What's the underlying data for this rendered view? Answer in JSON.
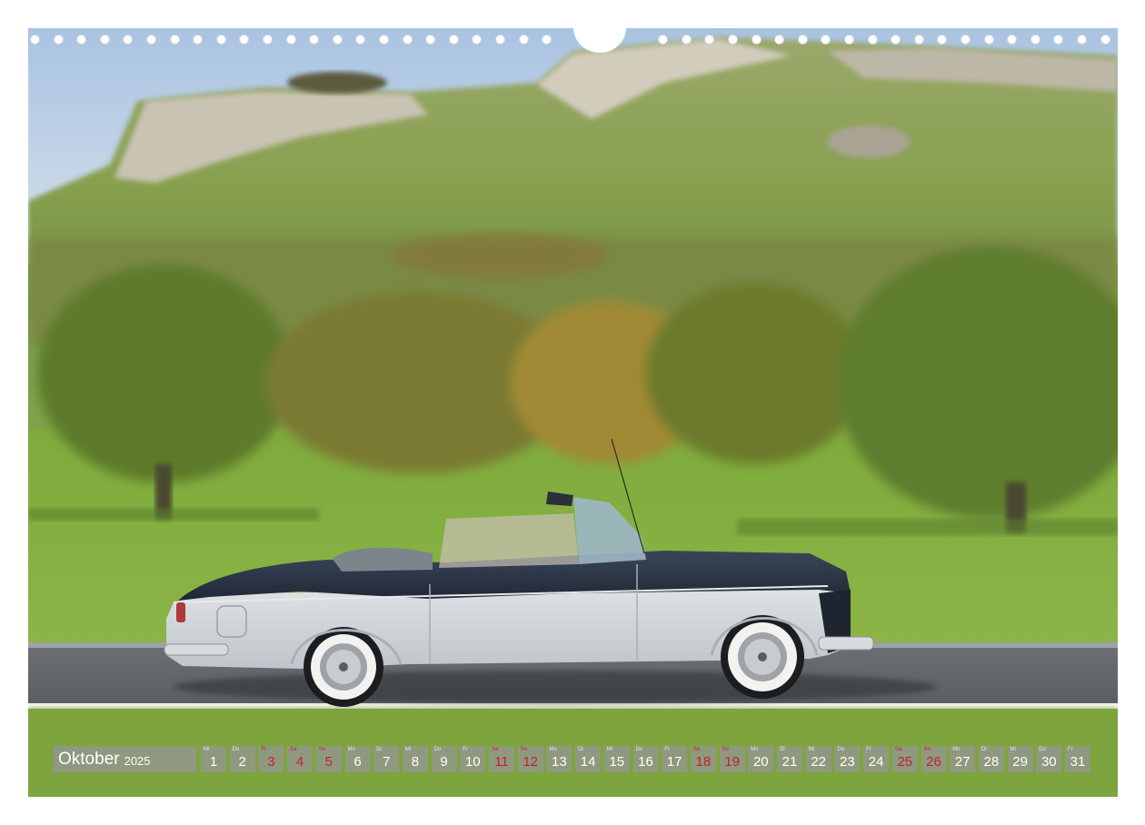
{
  "calendar": {
    "month": "Oktober",
    "year": "2025",
    "days": [
      {
        "n": "1",
        "wd": "Mi",
        "red": false
      },
      {
        "n": "2",
        "wd": "Do",
        "red": false
      },
      {
        "n": "3",
        "wd": "Fr",
        "red": true
      },
      {
        "n": "4",
        "wd": "Sa",
        "red": true
      },
      {
        "n": "5",
        "wd": "So",
        "red": true
      },
      {
        "n": "6",
        "wd": "Mo",
        "red": false
      },
      {
        "n": "7",
        "wd": "Di",
        "red": false
      },
      {
        "n": "8",
        "wd": "Mi",
        "red": false
      },
      {
        "n": "9",
        "wd": "Do",
        "red": false
      },
      {
        "n": "10",
        "wd": "Fr",
        "red": false
      },
      {
        "n": "11",
        "wd": "Sa",
        "red": true
      },
      {
        "n": "12",
        "wd": "So",
        "red": true
      },
      {
        "n": "13",
        "wd": "Mo",
        "red": false
      },
      {
        "n": "14",
        "wd": "Di",
        "red": false
      },
      {
        "n": "15",
        "wd": "Mi",
        "red": false
      },
      {
        "n": "16",
        "wd": "Do",
        "red": false
      },
      {
        "n": "17",
        "wd": "Fr",
        "red": false
      },
      {
        "n": "18",
        "wd": "Sa",
        "red": true
      },
      {
        "n": "19",
        "wd": "So",
        "red": true
      },
      {
        "n": "20",
        "wd": "Mo",
        "red": false
      },
      {
        "n": "21",
        "wd": "Di",
        "red": false
      },
      {
        "n": "22",
        "wd": "Mi",
        "red": false
      },
      {
        "n": "23",
        "wd": "Do",
        "red": false
      },
      {
        "n": "24",
        "wd": "Fr",
        "red": false
      },
      {
        "n": "25",
        "wd": "Sa",
        "red": true
      },
      {
        "n": "26",
        "wd": "So",
        "red": true
      },
      {
        "n": "27",
        "wd": "Mo",
        "red": false
      },
      {
        "n": "28",
        "wd": "Di",
        "red": false
      },
      {
        "n": "29",
        "wd": "Mi",
        "red": false
      },
      {
        "n": "30",
        "wd": "Do",
        "red": false
      },
      {
        "n": "31",
        "wd": "Fr",
        "red": false
      }
    ]
  },
  "colors": {
    "weekend": "#c4202b",
    "box": "#969696"
  }
}
